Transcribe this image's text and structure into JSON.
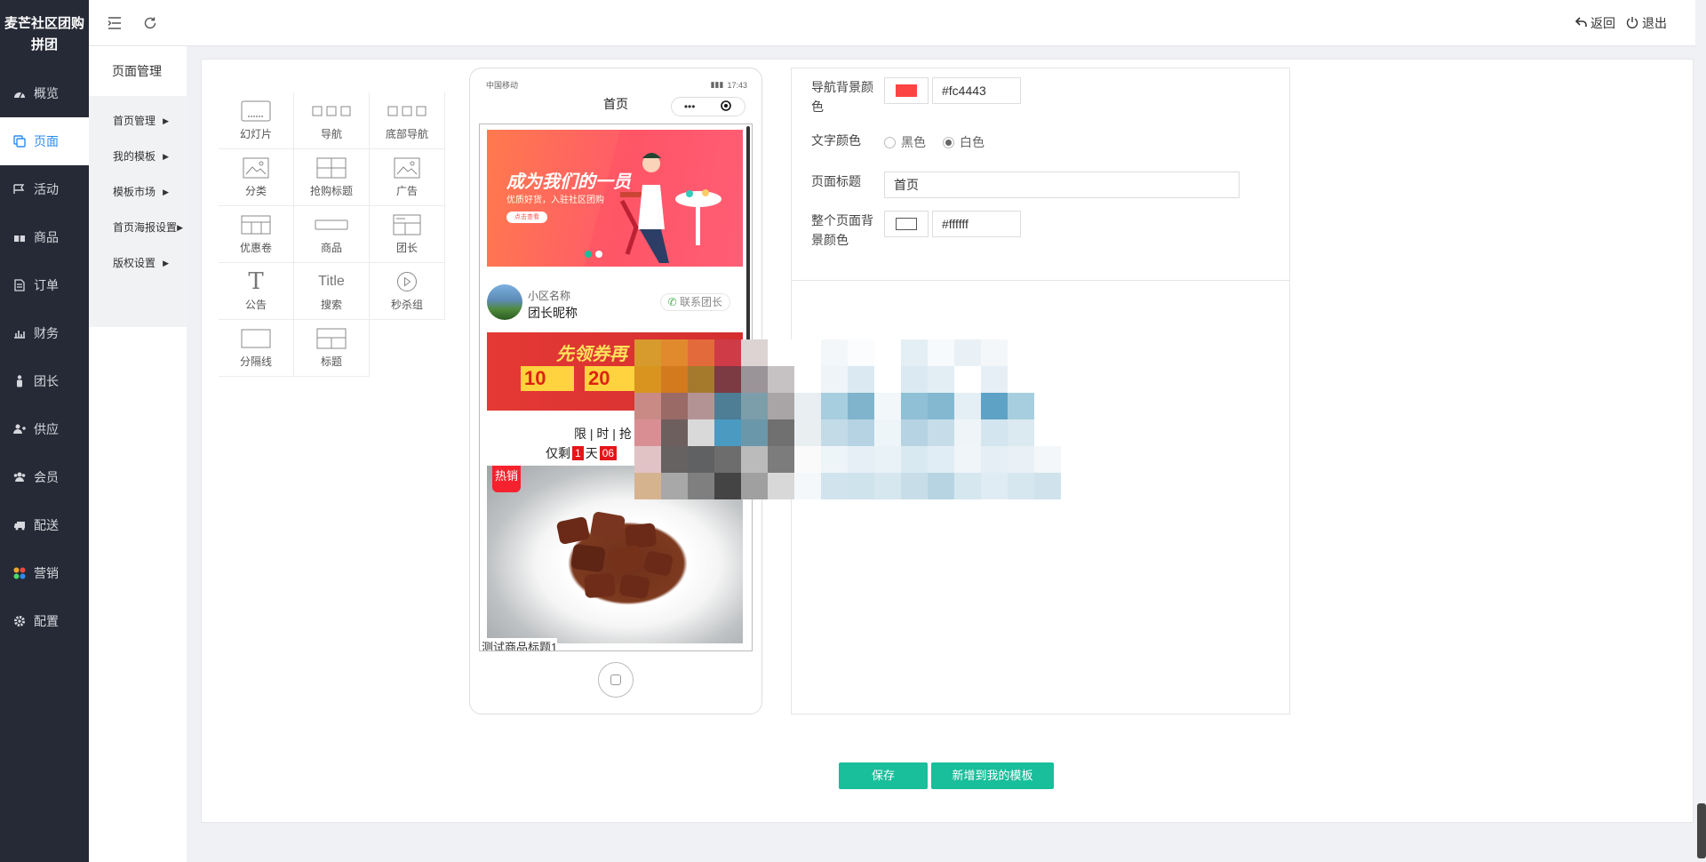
{
  "brand": "麦芒社区团购拼团",
  "sidebar": {
    "items": [
      {
        "label": "概览",
        "icon": "dashboard-icon"
      },
      {
        "label": "页面",
        "icon": "pages-icon"
      },
      {
        "label": "活动",
        "icon": "flag-icon"
      },
      {
        "label": "商品",
        "icon": "gift-icon"
      },
      {
        "label": "订单",
        "icon": "document-icon"
      },
      {
        "label": "财务",
        "icon": "chart-icon"
      },
      {
        "label": "团长",
        "icon": "person-icon"
      },
      {
        "label": "供应",
        "icon": "supplier-icon"
      },
      {
        "label": "会员",
        "icon": "users-icon"
      },
      {
        "label": "配送",
        "icon": "truck-icon"
      },
      {
        "label": "营销",
        "icon": "marketing-icon"
      },
      {
        "label": "配置",
        "icon": "gear-icon"
      }
    ],
    "active_index": 1
  },
  "topbar": {
    "back_label": "返回",
    "logout_label": "退出"
  },
  "submenu": {
    "title": "页面管理",
    "items": [
      {
        "label": "首页管理"
      },
      {
        "label": "我的模板"
      },
      {
        "label": "模板市场"
      },
      {
        "label": "首页海报设置"
      },
      {
        "label": "版权设置"
      }
    ]
  },
  "components": [
    {
      "label": "幻灯片",
      "icon": "slideshow-icon"
    },
    {
      "label": "导航",
      "icon": "nav-icon"
    },
    {
      "label": "底部导航",
      "icon": "bottom-nav-icon"
    },
    {
      "label": "分类",
      "icon": "category-icon"
    },
    {
      "label": "抢购标题",
      "icon": "flash-title-icon"
    },
    {
      "label": "广告",
      "icon": "ad-icon"
    },
    {
      "label": "优惠卷",
      "icon": "coupon-icon"
    },
    {
      "label": "商品",
      "icon": "product-icon"
    },
    {
      "label": "团长",
      "icon": "leader-icon"
    },
    {
      "label": "公告",
      "icon": "notice-icon",
      "glyph": "T"
    },
    {
      "label": "搜索",
      "icon": "search-icon",
      "glyph": "Title"
    },
    {
      "label": "秒杀组",
      "icon": "play-icon"
    },
    {
      "label": "分隔线",
      "icon": "divider-icon"
    },
    {
      "label": "标题",
      "icon": "title-icon"
    }
  ],
  "phone": {
    "carrier": "中国移动",
    "time": "17:43",
    "title": "首页",
    "capsule_dots": "•••",
    "banner_headline": "成为我们的一员",
    "banner_sub": "优质好货，入驻社区团购",
    "banner_button": "点击查看",
    "community": "小区名称",
    "leader_nick": "团长昵称",
    "contact": "联系团长",
    "coupon_banner": "先领券再",
    "coupon_a": "10",
    "coupon_b": "20",
    "flash_title": "限 | 时 | 抢",
    "countdown_prefix": "仅剩",
    "countdown_days": "1",
    "countdown_day_unit": "天",
    "countdown_hours": "06",
    "hot_badge": "热销",
    "product_title": "测试商品标题1"
  },
  "settings": {
    "nav_bg_label": "导航背景颜色",
    "nav_bg_value": "#fc4443",
    "text_color_label": "文字颜色",
    "text_color_options": [
      "黑色",
      "白色"
    ],
    "text_color_selected": "白色",
    "page_title_label": "页面标题",
    "page_title_value": "首页",
    "page_bg_label": "整个页面背景颜色",
    "page_bg_value": "#ffffff"
  },
  "actions": {
    "save": "保存",
    "add_template": "新增到我的模板"
  },
  "colors": {
    "sidebar_bg": "#262a36",
    "accent_blue": "#2d8cf0",
    "button_green": "#19be9b",
    "nav_bg": "#fc4443",
    "page_bg": "#ffffff"
  }
}
